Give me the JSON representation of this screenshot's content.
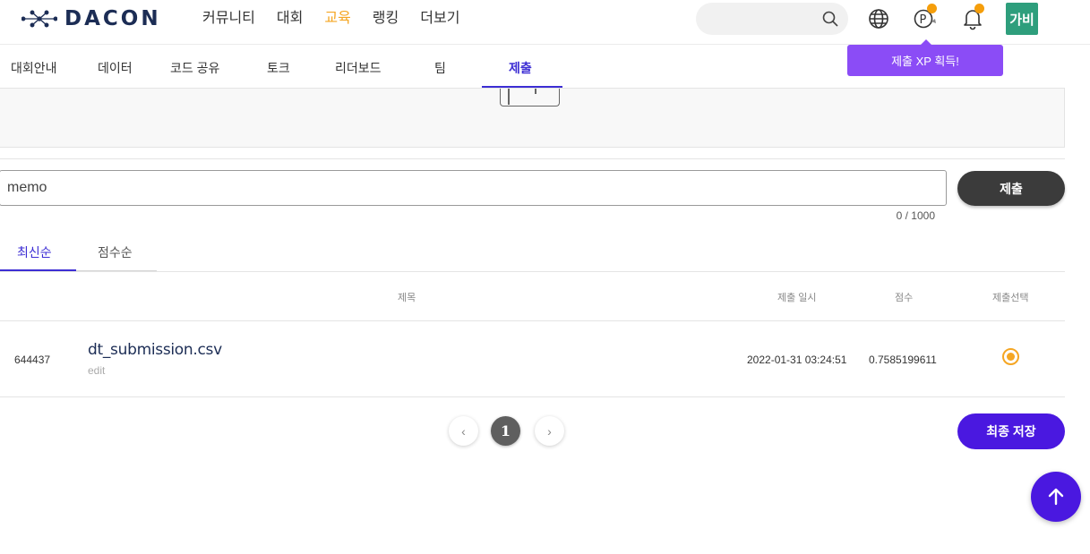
{
  "header": {
    "logo_text": "DACON",
    "nav": [
      {
        "label": "커뮤니티",
        "active": false
      },
      {
        "label": "대회",
        "active": false
      },
      {
        "label": "교육",
        "active": true
      },
      {
        "label": "랭킹",
        "active": false
      },
      {
        "label": "더보기",
        "active": false
      }
    ],
    "search_placeholder": "",
    "icons": [
      "globe-icon",
      "point-icon",
      "bell-icon"
    ],
    "avatar_label": "가비"
  },
  "tooltip": {
    "text": "제출 XP 획득!"
  },
  "subnav": {
    "tabs": [
      "대회안내",
      "데이터",
      "코드 공유",
      "토크",
      "리더보드",
      "팀",
      "제출"
    ],
    "active": "제출"
  },
  "memo": {
    "value": "memo",
    "char_count": "0 / 1000",
    "submit_label": "제출"
  },
  "sort_tabs": {
    "items": [
      "최신순",
      "점수순"
    ],
    "active": "최신순"
  },
  "table": {
    "headers": {
      "title": "제목",
      "date": "제출 일시",
      "score": "점수",
      "select": "제출선택"
    },
    "rows": [
      {
        "id": "644437",
        "file_name": "dt_submission.csv",
        "edit_label": "edit",
        "date": "2022-01-31 03:24:51",
        "score": "0.7585199611",
        "selected": true
      }
    ]
  },
  "pagination": {
    "current": "1",
    "prev": "‹",
    "next": "›"
  },
  "final_save_label": "최종 저장",
  "colors": {
    "accent_purple": "#4a18e0",
    "active_tab": "#3d2ed4",
    "active_nav": "#f5a623",
    "tooltip": "#8b4cf6",
    "avatar": "#2e9e7c",
    "notification_dot": "#f59e0b"
  }
}
